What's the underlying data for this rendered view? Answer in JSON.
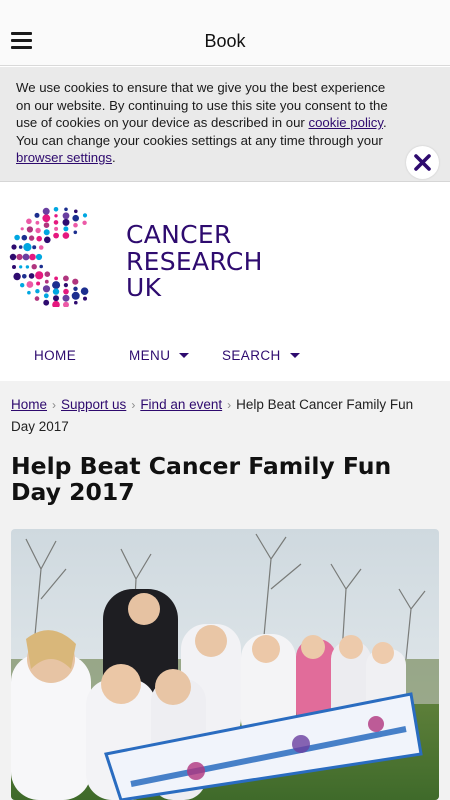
{
  "topbar": {
    "title": "Book",
    "menu_icon": "hamburger-menu-icon"
  },
  "cookie_banner": {
    "text_before_link1": "We use cookies to ensure that we give you the best experience on our website. By continuing to use this site you consent to the use of cookies on your device as described in our ",
    "link1": "cookie policy",
    "text_between": ". You can change your cookies settings at any time through your ",
    "link2": "browser settings",
    "text_after": ".",
    "close_icon": "close-icon",
    "close_color": "#2e0b6f"
  },
  "logo": {
    "line1": "CANCER",
    "line2": "RESEARCH",
    "line3": "UK",
    "brand_color": "#2e0b6f"
  },
  "nav": {
    "home": "HOME",
    "menu": "MENU",
    "search": "SEARCH"
  },
  "breadcrumb": {
    "items": [
      "Home",
      "Support us",
      "Find an event"
    ],
    "current": "Help Beat Cancer Family Fun Day 2017"
  },
  "page": {
    "title": "Help Beat Cancer Family Fun Day 2017"
  },
  "hero_image": {
    "alt": "Children holding a Cancer Research UK banner in a field"
  },
  "colors": {
    "accent": "#2e0b6f",
    "link": "#2e0a6e",
    "content_bg": "#f2f2f2",
    "banner_bg": "#eaeaea"
  }
}
